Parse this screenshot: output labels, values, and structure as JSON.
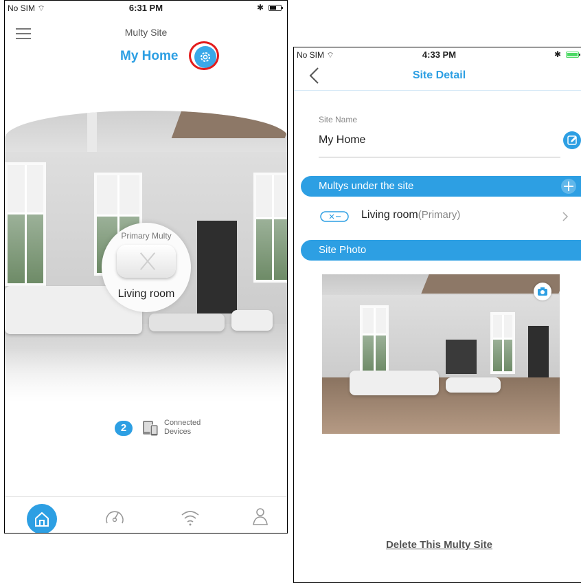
{
  "left_screen": {
    "status": {
      "carrier": "No SIM",
      "time": "6:31 PM",
      "bluetooth": "✱"
    },
    "header": {
      "subtitle": "Multy Site",
      "title": "My Home",
      "settings_icon": "gear-icon",
      "highlight_color": "#e31c1c"
    },
    "multy_card": {
      "top_label": "Primary Multy",
      "name": "Living room"
    },
    "connected": {
      "count": "2",
      "label": "Connected Devices"
    },
    "tabs": [
      "home-icon",
      "speed-gauge-icon",
      "wifi-icon",
      "users-icon"
    ],
    "accent": "#2d9fe3"
  },
  "right_screen": {
    "status": {
      "carrier": "No SIM",
      "time": "4:33 PM",
      "bluetooth": "✱",
      "battery_color": "#4cd964"
    },
    "header": {
      "title": "Site Detail"
    },
    "site_name": {
      "label": "Site Name",
      "value": "My Home"
    },
    "multys_section": {
      "title": "Multys under the site",
      "items": [
        {
          "name": "Living room",
          "tag": "(Primary)"
        }
      ]
    },
    "photo_section": {
      "title": "Site Photo"
    },
    "delete_label": "Delete This Multy Site"
  }
}
